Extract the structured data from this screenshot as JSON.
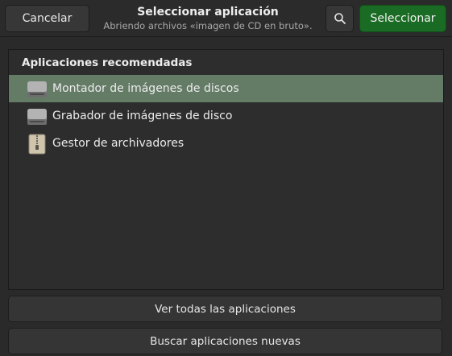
{
  "header": {
    "cancel_label": "Cancelar",
    "title": "Seleccionar aplicación",
    "subtitle": "Abriendo archivos «imagen de CD en bruto».",
    "search_icon": "search-icon",
    "select_label": "Seleccionar"
  },
  "recommended": {
    "heading": "Aplicaciones recomendadas",
    "items": [
      {
        "label": "Montador de imágenes de discos",
        "icon": "disk-drive-icon",
        "selected": true
      },
      {
        "label": "Grabador de imágenes de disco",
        "icon": "disk-drive-icon",
        "selected": false
      },
      {
        "label": "Gestor de archivadores",
        "icon": "archive-zip-icon",
        "selected": false
      }
    ]
  },
  "footer": {
    "view_all_label": "Ver todas las aplicaciones",
    "find_new_label": "Buscar aplicaciones nuevas"
  },
  "colors": {
    "accent": "#1a6b23",
    "selection": "#647b66",
    "background": "#2a2a2a"
  }
}
